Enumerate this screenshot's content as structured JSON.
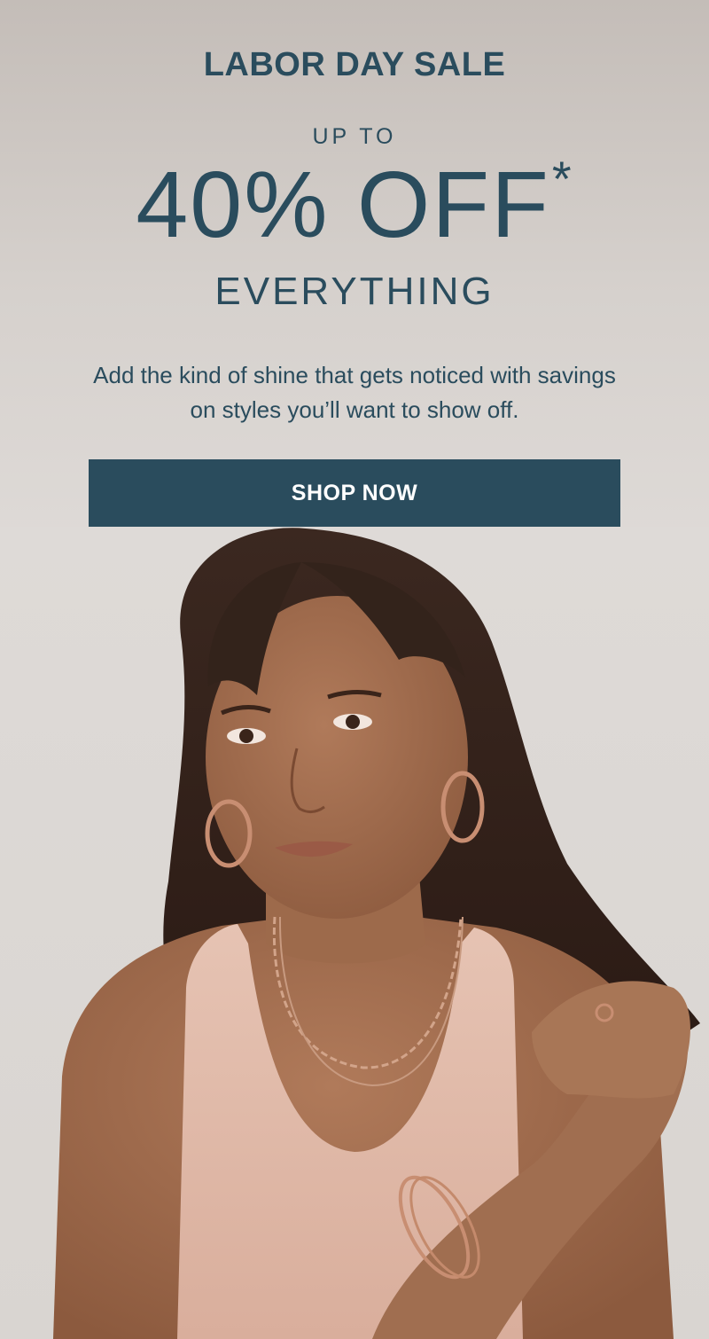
{
  "promo": {
    "eyebrow": "LABOR DAY SALE",
    "up_to": "UP TO",
    "headline": "40% OFF",
    "asterisk": "*",
    "subline": "EVERYTHING",
    "body": "Add the kind of shine that gets noticed with savings on styles you’ll want to show off.",
    "cta_label": "SHOP NOW"
  },
  "colors": {
    "brand_text": "#2a4c5d",
    "cta_background": "#2a4c5d",
    "cta_text": "#ffffff"
  },
  "hero_image": {
    "subject": "model-wearing-rose-gold-jewelry"
  }
}
